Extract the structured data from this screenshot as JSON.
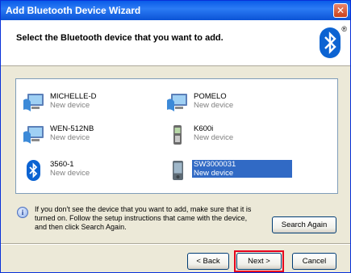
{
  "window": {
    "title": "Add Bluetooth Device Wizard",
    "close_glyph": "✕"
  },
  "header": {
    "prompt": "Select the Bluetooth device that you want to add.",
    "registered_mark": "®"
  },
  "devices": [
    {
      "name": "MICHELLE-D",
      "status": "New device",
      "icon": "computer-icon"
    },
    {
      "name": "POMELO",
      "status": "New device",
      "icon": "computer-icon"
    },
    {
      "name": "WEN-512NB",
      "status": "New device",
      "icon": "computer-icon"
    },
    {
      "name": "K600i",
      "status": "New device",
      "icon": "phone-icon"
    },
    {
      "name": "3560-1",
      "status": "New device",
      "icon": "bluetooth-icon"
    },
    {
      "name": "SW3000031",
      "status": "New device",
      "icon": "pda-icon",
      "selected": true
    }
  ],
  "hint": {
    "icon_glyph": "i",
    "line1": "If you don't see the device that you want to add, make sure that it is",
    "line2": "turned on. Follow the setup instructions that came with the device,",
    "line3": "and then click Search Again."
  },
  "buttons": {
    "search_again": "Search Again",
    "back": "< Back",
    "next": "Next >",
    "cancel": "Cancel"
  },
  "colors": {
    "titlebar": "#0a5be8",
    "selection": "#316ac5",
    "highlight": "#e5001c"
  }
}
